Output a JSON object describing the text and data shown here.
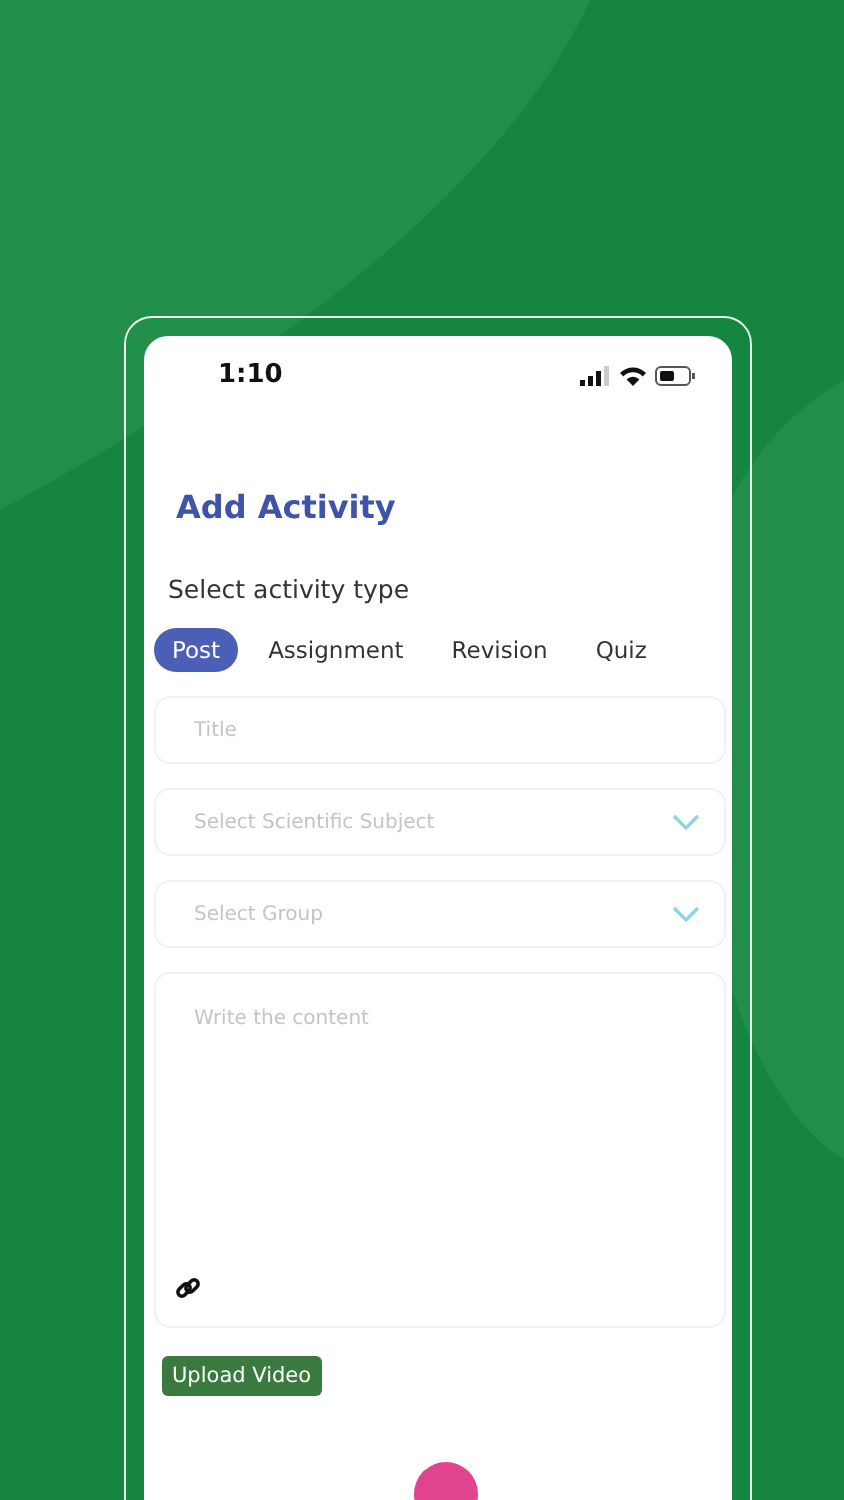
{
  "status_bar": {
    "time": "1:10"
  },
  "title": "Add Activity",
  "type_label": "Select activity type",
  "tabs": [
    {
      "label": "Post",
      "selected": true
    },
    {
      "label": "Assignment",
      "selected": false
    },
    {
      "label": "Revision",
      "selected": false
    },
    {
      "label": "Quiz",
      "selected": false
    }
  ],
  "fields": [
    {
      "kind": "text",
      "placeholder": "Title"
    },
    {
      "kind": "select",
      "placeholder": "Select Scientific Subject"
    },
    {
      "kind": "select",
      "placeholder": "Select Group"
    }
  ],
  "content": {
    "placeholder": "Write the content"
  },
  "upload_button": "Upload Video"
}
